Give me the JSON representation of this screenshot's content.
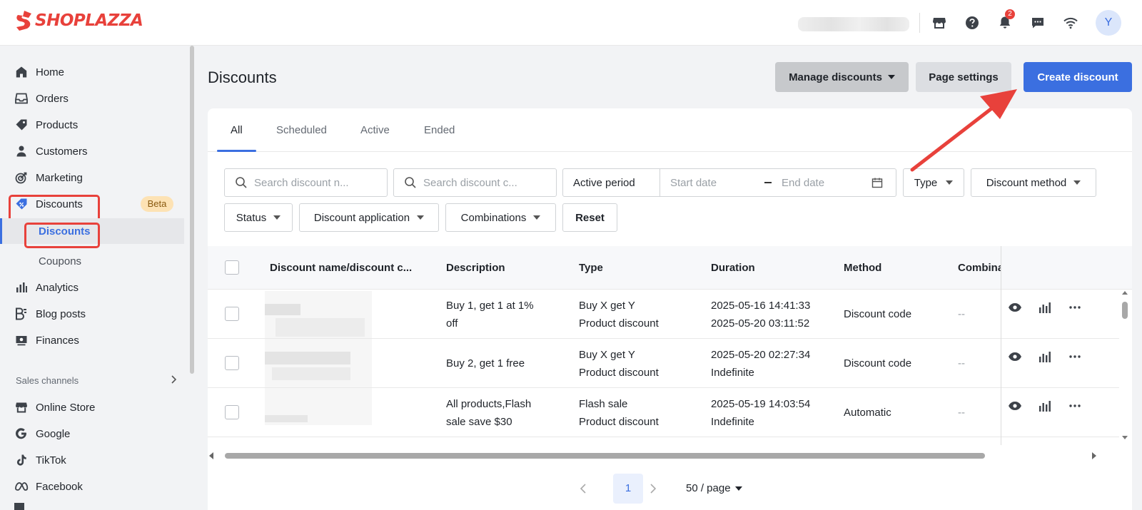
{
  "brand": {
    "name": "SHOPLAZZA",
    "accent": "#e8413b",
    "primary": "#3b6fe0"
  },
  "topbar": {
    "icons": [
      "store-icon",
      "help-icon",
      "bell-icon",
      "chat-icon",
      "wifi-icon"
    ],
    "notification_count": "2",
    "avatar_initial": "Y"
  },
  "sidebar": {
    "items": [
      {
        "label": "Home",
        "icon": "home-icon"
      },
      {
        "label": "Orders",
        "icon": "inbox-icon"
      },
      {
        "label": "Products",
        "icon": "tag-icon"
      },
      {
        "label": "Customers",
        "icon": "person-icon"
      },
      {
        "label": "Marketing",
        "icon": "target-icon"
      },
      {
        "label": "Discounts",
        "icon": "discount-tag-icon",
        "badge": "Beta"
      },
      {
        "label": "Analytics",
        "icon": "bar-chart-icon"
      },
      {
        "label": "Blog posts",
        "icon": "blog-icon"
      },
      {
        "label": "Finances",
        "icon": "finance-icon"
      }
    ],
    "sub_items": [
      {
        "label": "Discounts",
        "active": true
      },
      {
        "label": "Coupons",
        "active": false
      }
    ],
    "sales_channels_label": "Sales channels",
    "channels": [
      {
        "label": "Online Store",
        "icon": "store-icon"
      },
      {
        "label": "Google",
        "icon": "google-icon"
      },
      {
        "label": "TikTok",
        "icon": "tiktok-icon"
      },
      {
        "label": "Facebook",
        "icon": "meta-icon"
      }
    ]
  },
  "header": {
    "title": "Discounts",
    "manage_label": "Manage discounts",
    "page_settings_label": "Page settings",
    "create_label": "Create discount"
  },
  "tabs": [
    "All",
    "Scheduled",
    "Active",
    "Ended"
  ],
  "filters": {
    "search_name_placeholder": "Search discount n...",
    "search_code_placeholder": "Search discount c...",
    "active_period_label": "Active period",
    "start_date_placeholder": "Start date",
    "end_date_placeholder": "End date",
    "type_label": "Type",
    "method_label": "Discount method",
    "status_label": "Status",
    "application_label": "Discount application",
    "combinations_label": "Combinations",
    "reset_label": "Reset"
  },
  "table": {
    "columns": [
      "Discount name/discount c...",
      "Description",
      "Type",
      "Duration",
      "Method",
      "Combina"
    ],
    "rows": [
      {
        "description": [
          "Buy 1, get 1 at 1%",
          "off"
        ],
        "type": [
          "Buy X get Y",
          "Product discount"
        ],
        "duration": [
          "2025-05-16 14:41:33",
          "2025-05-20 03:11:52"
        ],
        "method": "Discount code",
        "combinations": "--"
      },
      {
        "description": [
          "Buy 2, get 1 free",
          ""
        ],
        "type": [
          "Buy X get Y",
          "Product discount"
        ],
        "duration": [
          "2025-05-20 02:27:34",
          "Indefinite"
        ],
        "method": "Discount code",
        "combinations": "--"
      },
      {
        "description": [
          "All products,Flash",
          "sale save $30"
        ],
        "type": [
          "Flash sale",
          "Product discount"
        ],
        "duration": [
          "2025-05-19 14:03:54",
          "Indefinite"
        ],
        "method": "Automatic",
        "combinations": "--"
      }
    ]
  },
  "pagination": {
    "current_page": "1",
    "per_page": "50 / page"
  }
}
